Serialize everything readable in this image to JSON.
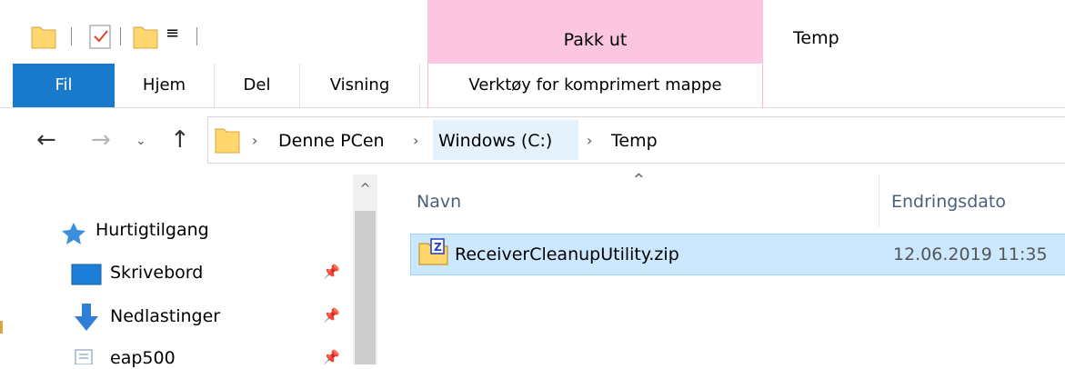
{
  "window": {
    "title": "Temp",
    "context_tab_group": "Pakk ut"
  },
  "quick_access_toolbar": {
    "icons": [
      "folder-icon",
      "properties-icon",
      "new-folder-icon",
      "customize-dropdown-icon"
    ]
  },
  "ribbon": {
    "tabs": [
      {
        "label": "Fil",
        "active": true
      },
      {
        "label": "Hjem"
      },
      {
        "label": "Del"
      },
      {
        "label": "Visning"
      },
      {
        "label": "Verktøy for komprimert mappe"
      }
    ]
  },
  "address": {
    "breadcrumbs": [
      "Denne PCen",
      "Windows (C:)",
      "Temp"
    ],
    "separator": "›"
  },
  "nav": {
    "quick_access": "Hurtigtilgang",
    "items": [
      {
        "label": "Skrivebord",
        "icon": "desktop-icon",
        "pinned": true
      },
      {
        "label": "Nedlastinger",
        "icon": "downloads-icon",
        "pinned": true
      },
      {
        "label": "eap500",
        "icon": "document-icon",
        "pinned": true
      }
    ]
  },
  "columns": {
    "name": "Navn",
    "date": "Endringsdato"
  },
  "files": [
    {
      "name": "ReceiverCleanupUtility.zip",
      "modified": "12.06.2019 11:35",
      "selected": true
    }
  ],
  "colors": {
    "accent": "#1979ca",
    "context_tab": "#fcc6e1",
    "selection": "#cce8ff",
    "folder": "#ffd76e"
  }
}
